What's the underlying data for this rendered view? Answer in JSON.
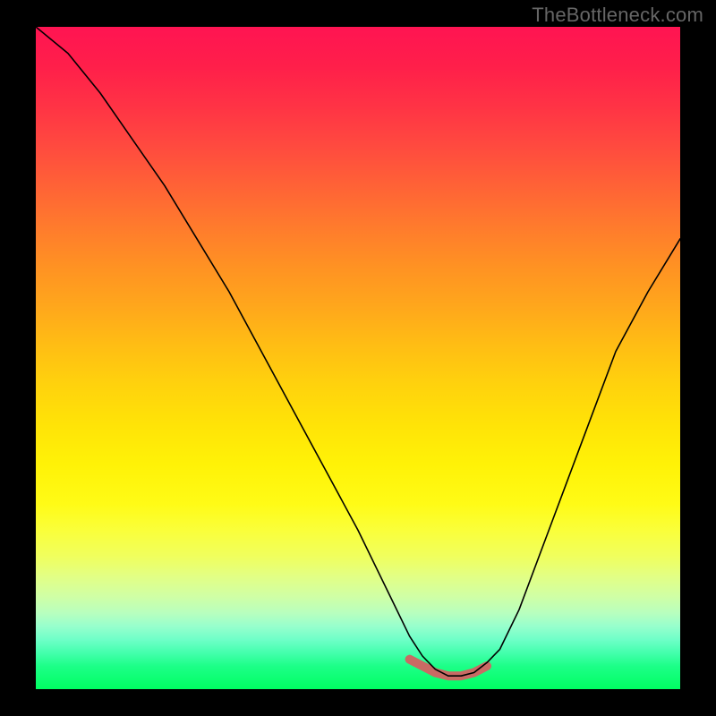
{
  "watermark": "TheBottleneck.com",
  "colors": {
    "frame_bg": "#000000",
    "watermark_text": "#666666",
    "curve_stroke": "#000000",
    "valley_stroke": "#c96a64",
    "gradient_top": "#ff1452",
    "gradient_bottom": "#00ff62"
  },
  "chart_data": {
    "type": "line",
    "title": "",
    "xlabel": "",
    "ylabel": "",
    "xlim": [
      0,
      100
    ],
    "ylim": [
      0,
      100
    ],
    "grid": false,
    "legend": null,
    "description": "V-shaped bottleneck curve over a vertical red-to-green gradient. The curve starts near the top-left, descends steeply to a near-zero minimum around x≈62–68, then rises again toward the right. The flat valley region (roughly x≈58–70) is overdrawn with a thicker muted-red stroke.",
    "series": [
      {
        "name": "bottleneck-curve",
        "x": [
          0,
          5,
          10,
          15,
          20,
          25,
          30,
          35,
          40,
          45,
          50,
          55,
          58,
          60,
          62,
          64,
          66,
          68,
          70,
          72,
          75,
          80,
          85,
          90,
          95,
          100
        ],
        "y": [
          100,
          96,
          90,
          83,
          76,
          68,
          60,
          51,
          42,
          33,
          24,
          14,
          8,
          5,
          3,
          2,
          2,
          2.5,
          4,
          6,
          12,
          25,
          38,
          51,
          60,
          68
        ]
      }
    ],
    "valley_highlight": {
      "x": [
        58,
        60,
        62,
        64,
        66,
        68,
        70
      ],
      "y": [
        4.5,
        3.5,
        2.5,
        2,
        2,
        2.5,
        3.5
      ]
    }
  }
}
